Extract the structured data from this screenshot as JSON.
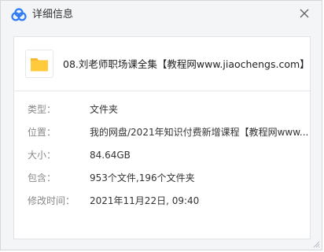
{
  "window": {
    "title": "详细信息"
  },
  "file": {
    "icon": "folder-icon",
    "name": "08.刘老师职场课全集【教程网www.jiaochengs.com】"
  },
  "details": {
    "type": {
      "label": "类型：",
      "value": "文件夹"
    },
    "location": {
      "label": "位置：",
      "value": "我的网盘/2021年知识付费新增课程【教程网www..."
    },
    "size": {
      "label": "大小：",
      "value": "84.64GB"
    },
    "contains": {
      "label": "包含：",
      "value": "953个文件,196个文件夹"
    },
    "modified": {
      "label": "修改时间：",
      "value": "2021年11月22日, 09:40"
    }
  },
  "colors": {
    "accent_blue": "#2f7cf6",
    "folder_yellow": "#ffcb3d",
    "label_gray": "#888888",
    "value_text": "#333333"
  }
}
